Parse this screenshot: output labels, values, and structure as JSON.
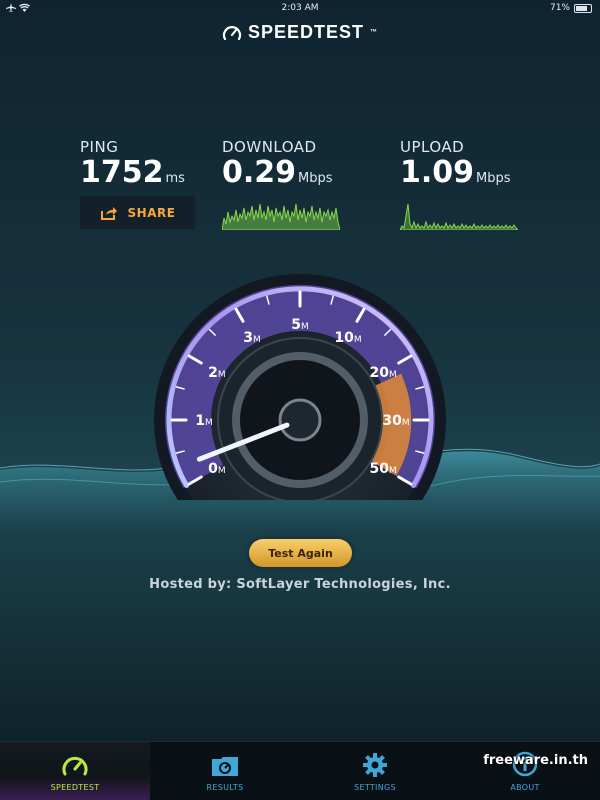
{
  "status": {
    "left_icons": "airplane-mode wifi",
    "time": "2:03 AM",
    "battery_percent": "71%"
  },
  "app": {
    "title": "SPEEDTEST",
    "trademark": "™"
  },
  "metrics": {
    "ping": {
      "label": "PING",
      "value": "1752",
      "unit": "ms"
    },
    "download": {
      "label": "DOWNLOAD",
      "value": "0.29",
      "unit": "Mbps"
    },
    "upload": {
      "label": "UPLOAD",
      "value": "1.09",
      "unit": "Mbps"
    }
  },
  "share": {
    "label": "SHARE",
    "icon": "share-icon"
  },
  "gauge": {
    "ticks": [
      {
        "num": "0",
        "suffix": "M"
      },
      {
        "num": "1",
        "suffix": "M"
      },
      {
        "num": "2",
        "suffix": "M"
      },
      {
        "num": "3",
        "suffix": "M"
      },
      {
        "num": "5",
        "suffix": "M"
      },
      {
        "num": "10",
        "suffix": "M"
      },
      {
        "num": "20",
        "suffix": "M"
      },
      {
        "num": "30",
        "suffix": "M"
      },
      {
        "num": "50",
        "suffix": "M"
      }
    ],
    "needle_value_mbps": 0.29,
    "colors": {
      "arc": "#8a7ce0",
      "upload_arc": "#d9863a",
      "needle": "#eef6ff"
    }
  },
  "actions": {
    "test_again": "Test Again"
  },
  "hosted_by": "Hosted by: SoftLayer Technologies, Inc.",
  "tabs": [
    {
      "label": "SPEEDTEST",
      "icon": "gauge-icon",
      "active": true
    },
    {
      "label": "RESULTS",
      "icon": "results-folder-icon",
      "active": false
    },
    {
      "label": "SETTINGS",
      "icon": "gear-icon",
      "active": false
    },
    {
      "label": "ABOUT",
      "icon": "info-icon",
      "active": false
    }
  ],
  "watermark": "freeware.in.th"
}
